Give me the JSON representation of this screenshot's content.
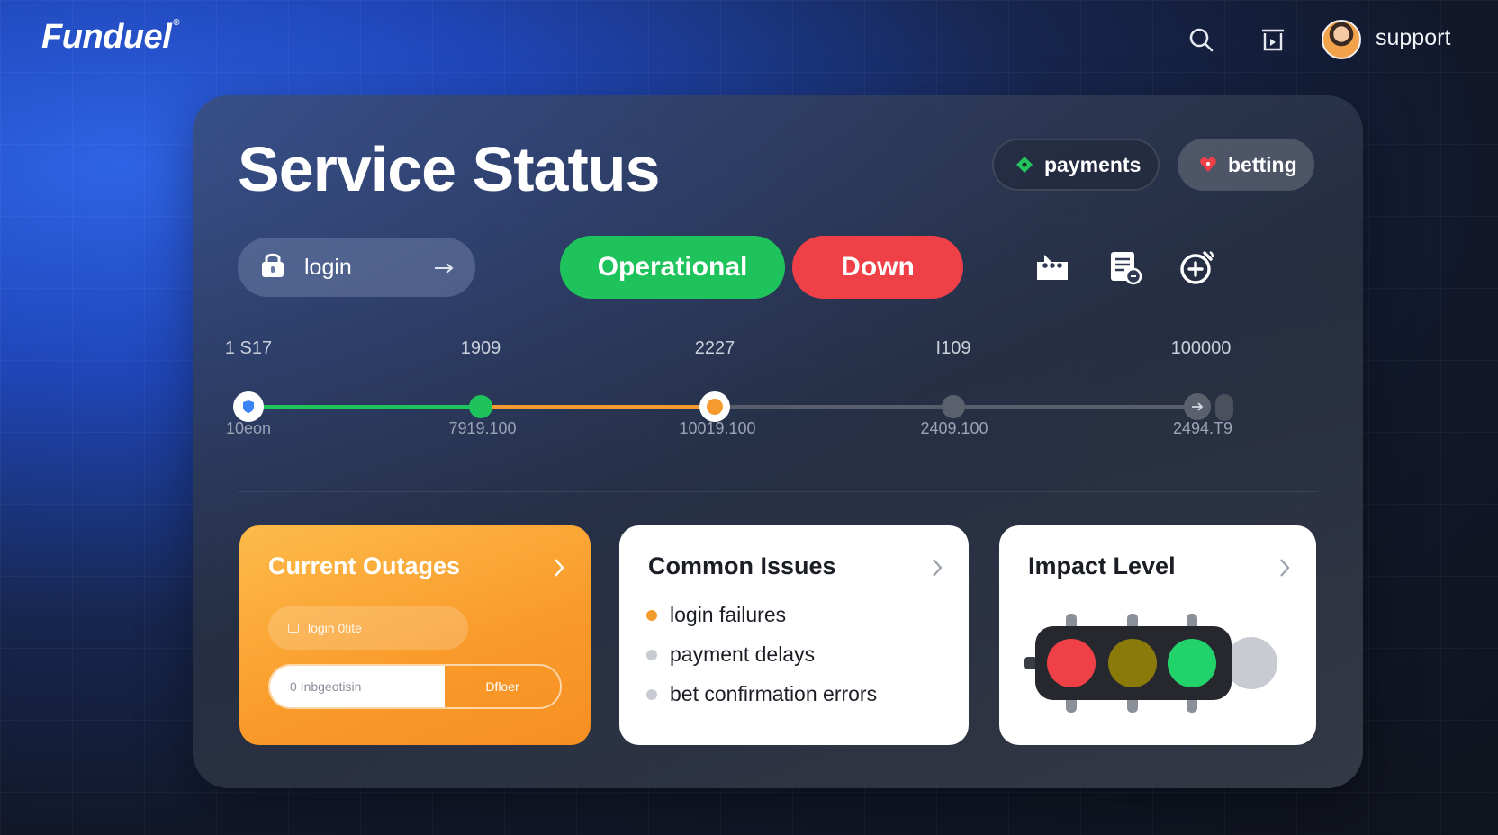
{
  "brand": {
    "name": "Funduel",
    "mark": "®"
  },
  "header": {
    "user_label": "support",
    "icons": [
      "search-icon",
      "share-icon",
      "avatar"
    ]
  },
  "page": {
    "title": "Service Status"
  },
  "tags": [
    {
      "label": "payments",
      "icon": "diamond-icon",
      "color": "#22c55e"
    },
    {
      "label": "betting",
      "icon": "heart-icon",
      "color": "#ef3f47"
    }
  ],
  "service_selector": {
    "label": "login",
    "icon": "lock-icon"
  },
  "status_buttons": {
    "operational": "Operational",
    "down": "Down"
  },
  "colors": {
    "operational": "#1fc35b",
    "down": "#ef3f47",
    "progress_mid": "#f59a2e",
    "inactive": "#5a606c"
  },
  "timeline": {
    "top_labels": [
      "1 S17",
      "1909",
      "2227",
      "I109",
      "100000"
    ],
    "bottom_labels": [
      "10eon",
      "7919.100",
      "10019.100",
      "2409.100",
      "2494.T9"
    ]
  },
  "cards": {
    "outages": {
      "title": "Current Outages",
      "field_text": "login 0tite",
      "input_text": "0 Inbgeotisin",
      "button_label": "Dfloer"
    },
    "issues": {
      "title": "Common Issues",
      "items": [
        {
          "label": "login failures",
          "color": "#f39a2c"
        },
        {
          "label": "payment delays",
          "color": "#c8ccd2"
        },
        {
          "label": "bet confirmation errors",
          "color": "#c8ccd2"
        }
      ]
    },
    "impact": {
      "title": "Impact Level",
      "lights": [
        "#ef3f47",
        "#8a7a0a",
        "#22d36b",
        "#c8ccd2"
      ]
    }
  }
}
